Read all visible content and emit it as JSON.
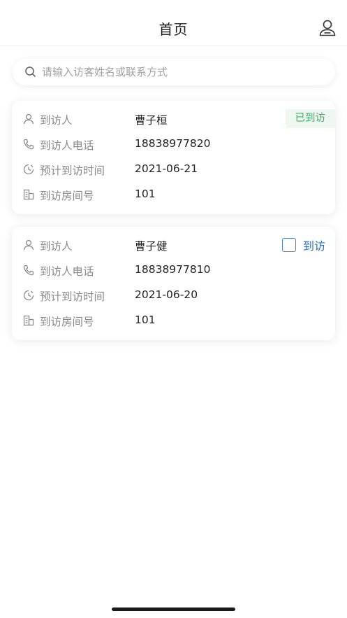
{
  "header": {
    "title": "首页"
  },
  "search": {
    "placeholder": "请输入访客姓名或联系方式"
  },
  "labels": {
    "visitor": "到访人",
    "phone": "到访人电话",
    "time": "预计到访时间",
    "room": "到访房间号"
  },
  "visits": [
    {
      "name": "曹子桓",
      "phone": "18838977820",
      "date": "2021-06-21",
      "room": "101",
      "status": "已到访",
      "checked": false
    },
    {
      "name": "曹子健",
      "phone": "18838977810",
      "date": "2021-06-20",
      "room": "101",
      "action": "到访",
      "checked": false
    }
  ],
  "colors": {
    "visited_green": "#3fb06b",
    "action_blue": "#2f6fb5"
  }
}
